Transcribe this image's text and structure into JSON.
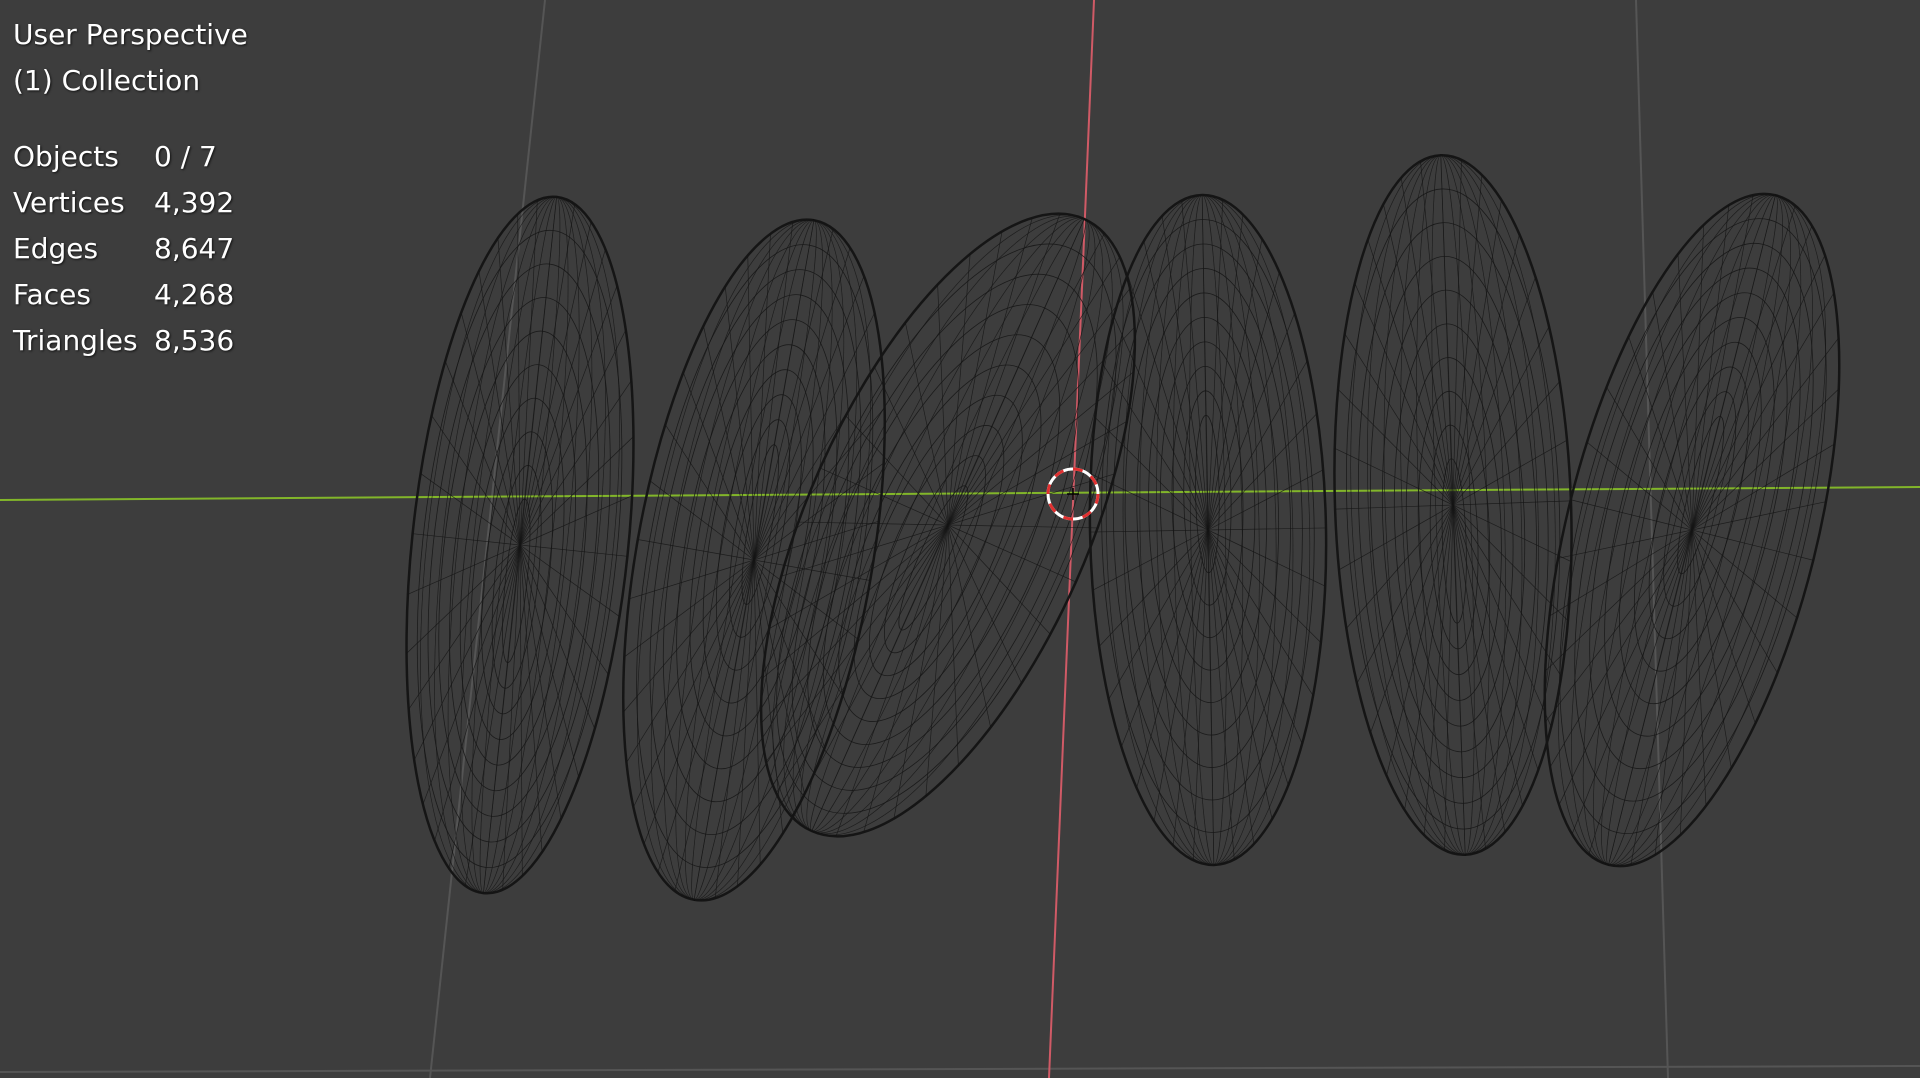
{
  "viewport": {
    "view_name": "User Perspective",
    "collection": "(1) Collection",
    "shading": "wireframe",
    "object_count": 7
  },
  "stats": [
    {
      "label": "Objects",
      "value": "0 / 7"
    },
    {
      "label": "Vertices",
      "value": "4,392"
    },
    {
      "label": "Edges",
      "value": "8,647"
    },
    {
      "label": "Faces",
      "value": "4,268"
    },
    {
      "label": "Triangles",
      "value": "8,536"
    }
  ],
  "colors": {
    "background": "#3d3d3d",
    "grid": "#555555",
    "wireframe": "#151515",
    "x_axis": "#d05a66",
    "y_axis": "#82b62a",
    "cursor_red": "#e03030",
    "cursor_white": "#ffffff",
    "text": "#ffffff"
  },
  "icons": {
    "cursor": "3d-cursor-icon"
  }
}
